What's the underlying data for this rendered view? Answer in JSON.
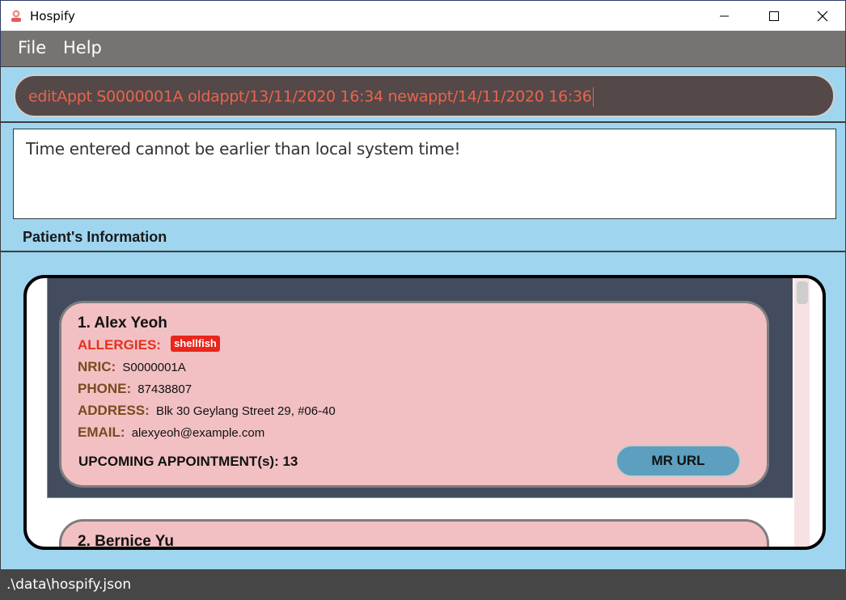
{
  "window": {
    "title": "Hospify",
    "app_icon": "hospify-logo-icon",
    "controls": [
      "minimize-icon",
      "maximize-icon",
      "close-icon"
    ]
  },
  "menu": {
    "file": "File",
    "help": "Help"
  },
  "command": {
    "value": "editAppt S0000001A oldappt/13/11/2020 16:34 newappt/14/11/2020 16:36",
    "text_color": "#e8644e"
  },
  "result": {
    "message": "Time entered cannot be earlier than local system time!"
  },
  "patients_section": {
    "title": "Patient's Information",
    "patients": [
      {
        "index_name": "1.  Alex Yeoh",
        "allergies_label": "ALLERGIES:",
        "allergies": [
          "shellfish"
        ],
        "nric_label": "NRIC:",
        "nric": "S0000001A",
        "phone_label": "PHONE:",
        "phone": "87438807",
        "address_label": "ADDRESS:",
        "address": "Blk 30 Geylang Street 29, #06-40",
        "email_label": "EMAIL:",
        "email": "alexyeoh@example.com",
        "upcoming": "UPCOMING APPOINTMENT(s): 13",
        "mr_button": "MR URL"
      },
      {
        "index_name": "2.  Bernice Yu"
      }
    ]
  },
  "status": {
    "path": ".\\data\\hospify.json"
  },
  "colors": {
    "accent_blue": "#9fd5ef",
    "card_pink": "#f2c0c3",
    "allergy_red": "#e4321d",
    "label_brown": "#7a4a1e"
  }
}
